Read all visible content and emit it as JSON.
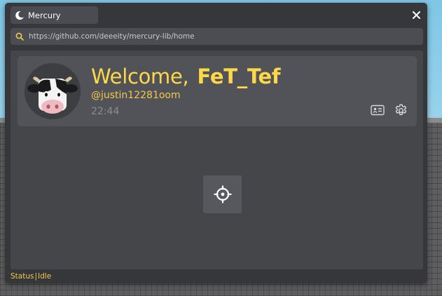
{
  "window": {
    "title": "Mercury",
    "url": "https://github.com/deeeity/mercury-lib/home"
  },
  "profile": {
    "greeting": "Welcome,",
    "display_name": "FeT_Tef",
    "handle": "@justin12281oom",
    "time": "22:44"
  },
  "status": {
    "label": "Status",
    "separator": "|",
    "value": "Idle"
  },
  "icons": {
    "title": "moon-icon",
    "close": "close-icon",
    "search": "search-icon",
    "id_card": "id-card-icon",
    "settings": "gear-icon",
    "locate": "crosshair-icon"
  },
  "colors": {
    "accent": "#ffd84a",
    "window_bg": "#35373b",
    "content_bg": "#44464a",
    "card_bg": "#515358"
  }
}
